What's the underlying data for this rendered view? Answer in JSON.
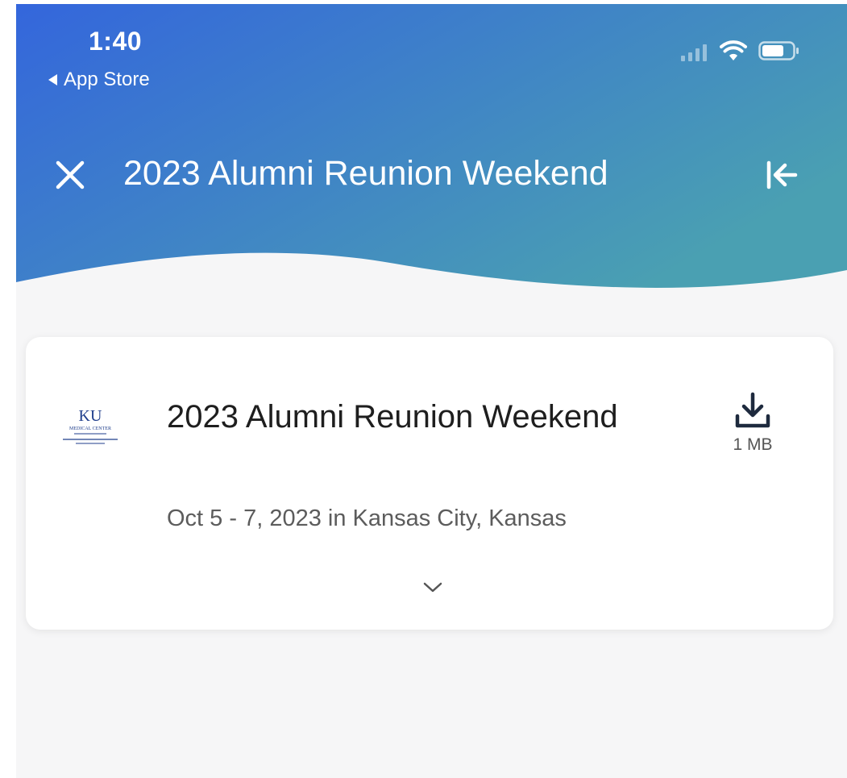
{
  "status_bar": {
    "time": "1:40",
    "back_app": "App Store",
    "icons": [
      "cellular-signal-icon",
      "wifi-icon",
      "battery-icon"
    ]
  },
  "nav": {
    "title": "2023 Alumni Reunion Weekend",
    "close_icon": "close-icon",
    "collapse_icon": "collapse-left-icon"
  },
  "event": {
    "logo_text": "KU",
    "logo_subtext": "MEDICAL CENTER",
    "title": "2023 Alumni Reunion Weekend",
    "subtitle": "Oct 5 - 7, 2023 in Kansas City, Kansas",
    "download_size": "1 MB",
    "download_icon": "download-icon",
    "expand_icon": "chevron-down-icon"
  },
  "colors": {
    "header_gradient_start": "#3466dc",
    "header_gradient_end": "#4aa0b2",
    "background": "#f6f6f7",
    "card": "#ffffff",
    "title_text": "#1e1e1e",
    "subtitle_text": "#5c5c5c",
    "logo_blue": "#1f3e8c"
  }
}
